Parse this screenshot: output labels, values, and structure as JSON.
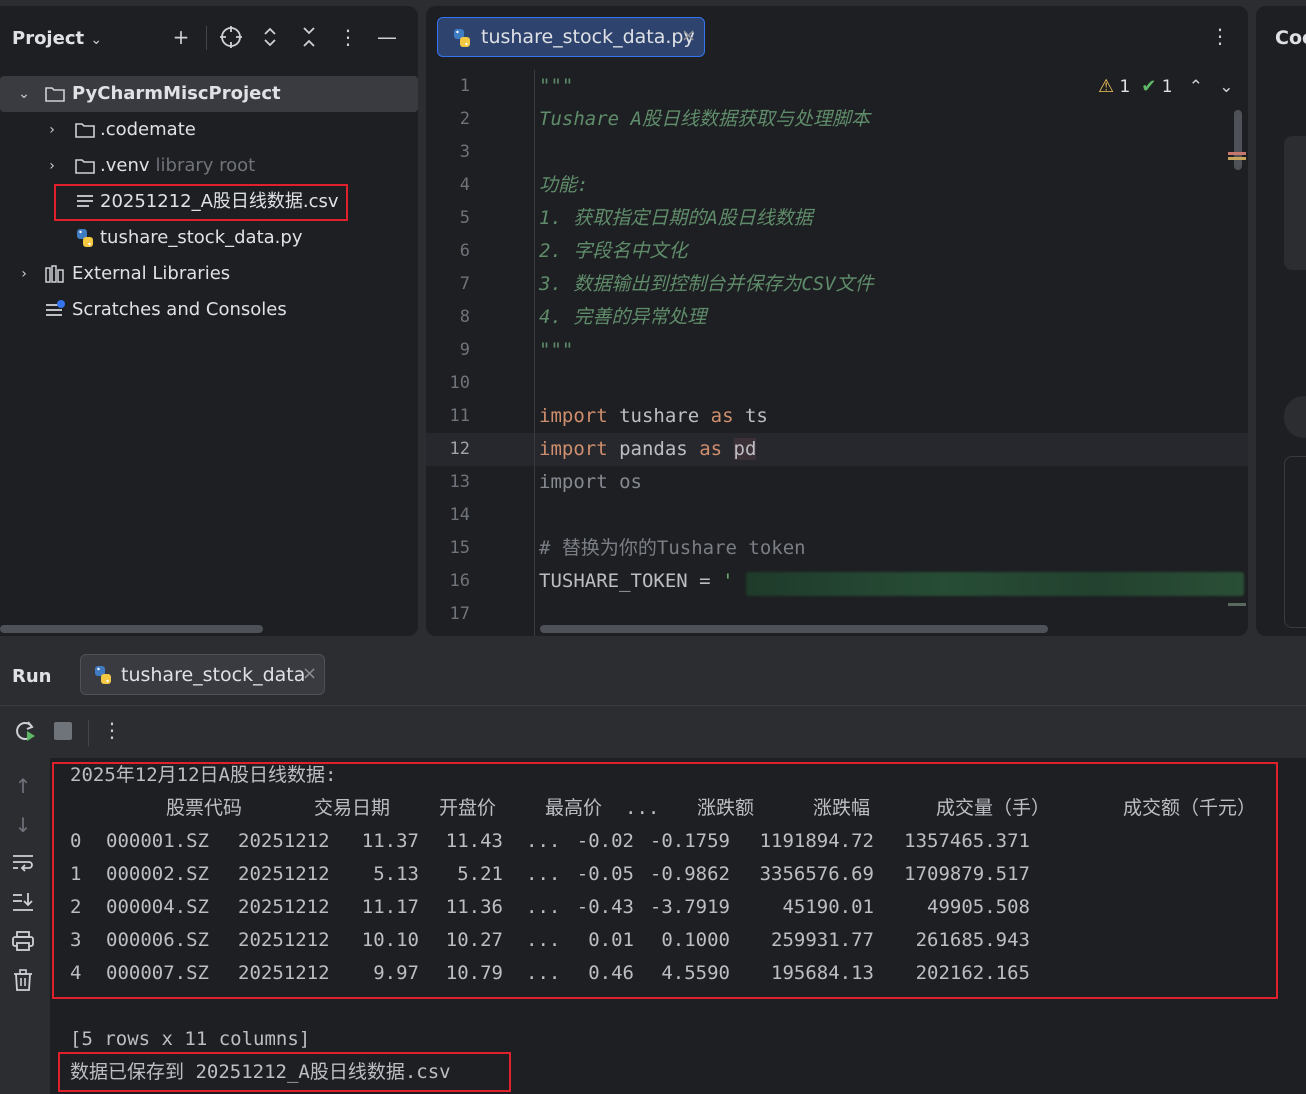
{
  "project": {
    "title": "Project",
    "tree": [
      {
        "label": "PyCharmMiscProject",
        "kind": "folder",
        "expanded": true,
        "bold": true
      },
      {
        "label": ".codemate",
        "kind": "folder",
        "expanded": false
      },
      {
        "label": ".venv",
        "hint": "library root",
        "kind": "folder",
        "expanded": false
      },
      {
        "label": "20251212_A股日线数据.csv",
        "kind": "csv-file"
      },
      {
        "label": "tushare_stock_data.py",
        "kind": "python-file"
      },
      {
        "label": "External Libraries",
        "kind": "library",
        "expanded": false
      },
      {
        "label": "Scratches and Consoles",
        "kind": "scratches"
      }
    ]
  },
  "editor": {
    "tab_label": "tushare_stock_data.py",
    "inspections": {
      "warnings": "1",
      "ok": "1"
    },
    "current_line": "12",
    "lines": [
      {
        "n": "1",
        "text": "\"\"\""
      },
      {
        "n": "2",
        "text": "Tushare A股日线数据获取与处理脚本"
      },
      {
        "n": "3",
        "text": ""
      },
      {
        "n": "4",
        "text": "功能:"
      },
      {
        "n": "5",
        "text": "1. 获取指定日期的A股日线数据"
      },
      {
        "n": "6",
        "text": "2. 字段名中文化"
      },
      {
        "n": "7",
        "text": "3. 数据输出到控制台并保存为CSV文件"
      },
      {
        "n": "8",
        "text": "4. 完善的异常处理"
      },
      {
        "n": "9",
        "text": "\"\"\""
      },
      {
        "n": "10",
        "text": ""
      },
      {
        "n": "11",
        "kw1": "import",
        "mod": "tushare",
        "kw2": "as",
        "alias": "ts"
      },
      {
        "n": "12",
        "kw1": "import",
        "mod": "pandas",
        "kw2": "as",
        "alias": "pd"
      },
      {
        "n": "13",
        "kw1": "import",
        "mod": "os"
      },
      {
        "n": "14",
        "text": ""
      },
      {
        "n": "15",
        "text": "# 替换为你的Tushare token"
      },
      {
        "n": "16",
        "var": "TUSHARE_TOKEN",
        "op": "=",
        "str": "'"
      },
      {
        "n": "17",
        "text": ""
      }
    ]
  },
  "right_panel": {
    "title": "Coc"
  },
  "run": {
    "title": "Run",
    "tab_label": "tushare_stock_data",
    "console": {
      "heading": "2025年12月12日A股日线数据:",
      "columns": [
        "股票代码",
        "交易日期",
        "开盘价",
        "最高价",
        "...",
        "涨跌额",
        "涨跌幅",
        "成交量（手）",
        "成交额（千元）"
      ],
      "rows": [
        [
          "0",
          "000001.SZ",
          "20251212",
          "11.37",
          "11.43",
          "...",
          "-0.02",
          "-0.1759",
          "1191894.72",
          "1357465.371"
        ],
        [
          "1",
          "000002.SZ",
          "20251212",
          "5.13",
          "5.21",
          "...",
          "-0.05",
          "-0.9862",
          "3356576.69",
          "1709879.517"
        ],
        [
          "2",
          "000004.SZ",
          "20251212",
          "11.17",
          "11.36",
          "...",
          "-0.43",
          "-3.7919",
          "45190.01",
          "49905.508"
        ],
        [
          "3",
          "000006.SZ",
          "20251212",
          "10.10",
          "10.27",
          "...",
          "0.01",
          "0.1000",
          "259931.77",
          "261685.943"
        ],
        [
          "4",
          "000007.SZ",
          "20251212",
          "9.97",
          "10.79",
          "...",
          "0.46",
          "4.5590",
          "195684.13",
          "202162.165"
        ]
      ],
      "shape": "[5 rows x 11 columns]",
      "saved_msg": "数据已保存到 20251212_A股日线数据.csv"
    }
  },
  "colors": {
    "highlight_border": "#e0202a",
    "tab_selected_bg": "#2e436e",
    "tab_selected_border": "#3574f0",
    "keyword": "#cf8e6d",
    "docstring": "#5f8c6a"
  }
}
